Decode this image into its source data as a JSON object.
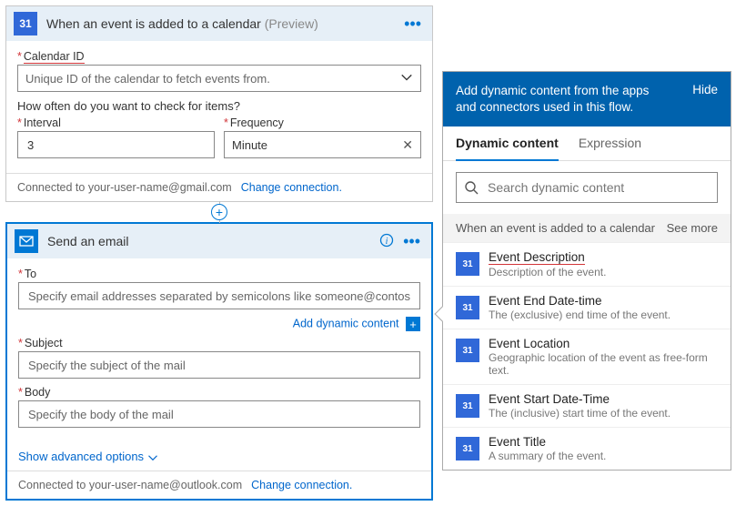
{
  "trigger": {
    "title": "When an event is added to a calendar",
    "preview": "(Preview)",
    "calendar_label": "Calendar ID",
    "calendar_placeholder": "Unique ID of the calendar to fetch events from.",
    "check_caption": "How often do you want to check for items?",
    "interval_label": "Interval",
    "interval_value": "3",
    "frequency_label": "Frequency",
    "frequency_value": "Minute",
    "connected": "Connected to your-user-name@gmail.com",
    "change": "Change connection."
  },
  "action": {
    "title": "Send an email",
    "to_label": "To",
    "to_placeholder": "Specify email addresses separated by semicolons like someone@contoso.com",
    "subject_label": "Subject",
    "subject_placeholder": "Specify the subject of the mail",
    "body_label": "Body",
    "body_placeholder": "Specify the body of the mail",
    "add_dynamic": "Add dynamic content",
    "advanced": "Show advanced options",
    "connected": "Connected to your-user-name@outlook.com",
    "change": "Change connection."
  },
  "panel": {
    "header": "Add dynamic content from the apps and connectors used in this flow.",
    "hide": "Hide",
    "tab_dynamic": "Dynamic content",
    "tab_expression": "Expression",
    "search_placeholder": "Search dynamic content",
    "section": "When an event is added to a calendar",
    "see_more": "See more",
    "items": [
      {
        "title": "Event Description",
        "desc": "Description of the event.",
        "hl": true
      },
      {
        "title": "Event End Date-time",
        "desc": "The (exclusive) end time of the event."
      },
      {
        "title": "Event Location",
        "desc": "Geographic location of the event as free-form text."
      },
      {
        "title": "Event Start Date-Time",
        "desc": "The (inclusive) start time of the event."
      },
      {
        "title": "Event Title",
        "desc": "A summary of the event."
      }
    ]
  }
}
